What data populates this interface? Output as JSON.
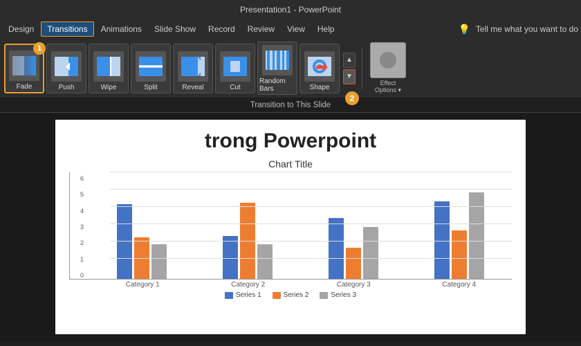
{
  "title_bar": {
    "text": "Presentation1 - PowerPoint"
  },
  "menu": {
    "items": [
      {
        "label": "Design",
        "active": false
      },
      {
        "label": "Transitions",
        "active": true
      },
      {
        "label": "Animations",
        "active": false
      },
      {
        "label": "Slide Show",
        "active": false
      },
      {
        "label": "Record",
        "active": false
      },
      {
        "label": "Review",
        "active": false
      },
      {
        "label": "View",
        "active": false
      },
      {
        "label": "Help",
        "active": false
      }
    ],
    "search_placeholder": "Tell me what you want to do"
  },
  "ribbon": {
    "section_label": "Transition to This Slide",
    "transitions": [
      {
        "label": "Fade",
        "icon": "fade"
      },
      {
        "label": "Push",
        "icon": "push"
      },
      {
        "label": "Wipe",
        "icon": "wipe"
      },
      {
        "label": "Split",
        "icon": "split"
      },
      {
        "label": "Reveal",
        "icon": "reveal"
      },
      {
        "label": "Cut",
        "icon": "cut"
      },
      {
        "label": "Random Bars",
        "icon": "randombars"
      },
      {
        "label": "Shape",
        "icon": "shape"
      }
    ],
    "effect_options_label": "Effect\nOptions",
    "badge_1": "1",
    "badge_2": "2"
  },
  "subtitle_bar": {
    "text": "Transition to This Slide"
  },
  "slide": {
    "title": "trong Powerpoint",
    "chart": {
      "title": "Chart Title",
      "y_labels": [
        "0",
        "1",
        "2",
        "3",
        "4",
        "5",
        "6"
      ],
      "categories": [
        "Category 1",
        "Category 2",
        "Category 3",
        "Category 4"
      ],
      "series": [
        {
          "name": "Series 1",
          "color": "blue",
          "values": [
            4.3,
            2.5,
            3.5,
            4.5
          ]
        },
        {
          "name": "Series 2",
          "color": "orange",
          "values": [
            2.4,
            4.4,
            1.8,
            2.8
          ]
        },
        {
          "name": "Series 3",
          "color": "gray",
          "values": [
            2.0,
            2.0,
            3.0,
            5.0
          ]
        }
      ],
      "legend": [
        {
          "label": "Series 1",
          "color": "#4472c4"
        },
        {
          "label": "Series 2",
          "color": "#ed7d31"
        },
        {
          "label": "Series 3",
          "color": "#a5a5a5"
        }
      ]
    }
  }
}
